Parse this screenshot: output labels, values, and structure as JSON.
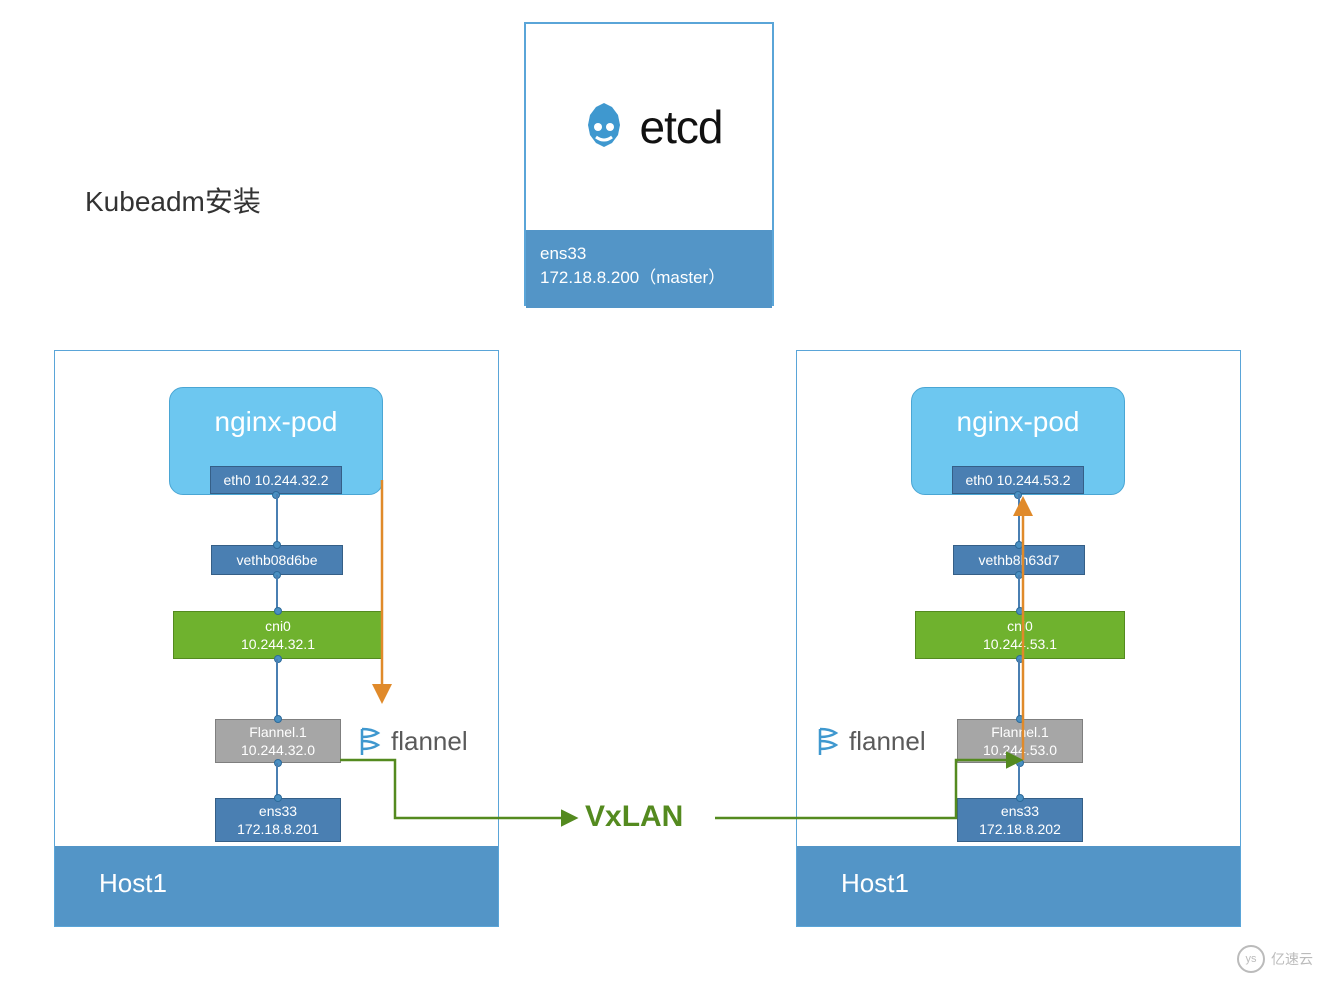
{
  "title": "Kubeadm安装",
  "master": {
    "logo_text": "etcd",
    "iface": "ens33",
    "ip_label": "172.18.8.200（master）"
  },
  "vxlan_label": "VxLAN",
  "hosts": [
    {
      "host_label": "Host1",
      "pod_name": "nginx-pod",
      "pod_eth": "eth0 10.244.32.2",
      "veth": "vethb08d6be",
      "cni_name": "cni0",
      "cni_ip": "10.244.32.1",
      "flannel_name": "Flannel.1",
      "flannel_ip": "10.244.32.0",
      "flannel_brand": "flannel",
      "ens_name": "ens33",
      "ens_ip": "172.18.8.201"
    },
    {
      "host_label": "Host1",
      "pod_name": "nginx-pod",
      "pod_eth": "eth0 10.244.53.2",
      "veth": "vethb8h63d7",
      "cni_name": "cni0",
      "cni_ip": "10.244.53.1",
      "flannel_name": "Flannel.1",
      "flannel_ip": "10.244.53.0",
      "flannel_brand": "flannel",
      "ens_name": "ens33",
      "ens_ip": "172.18.8.202"
    }
  ],
  "watermark": "亿速云",
  "colors": {
    "blue": "#5395c7",
    "lightblue": "#6dc7f0",
    "green": "#6fb22e",
    "gray": "#a6a6a6",
    "orange": "#e08a2a"
  },
  "chart_data": {
    "type": "diagram",
    "description": "Kubernetes flannel VxLAN overlay network between two hosts via etcd master",
    "nodes": [
      {
        "id": "master",
        "label": "etcd",
        "iface": "ens33",
        "ip": "172.18.8.200",
        "role": "master"
      },
      {
        "id": "host1",
        "label": "Host1",
        "ens_ip": "172.18.8.201",
        "flannel_ip": "10.244.32.0",
        "cni_ip": "10.244.32.1",
        "pod_ip": "10.244.32.2",
        "veth": "vethb08d6be"
      },
      {
        "id": "host2",
        "label": "Host1",
        "ens_ip": "172.18.8.202",
        "flannel_ip": "10.244.53.0",
        "cni_ip": "10.244.53.1",
        "pod_ip": "10.244.53.2",
        "veth": "vethb8h63d7"
      }
    ],
    "edges": [
      {
        "from": "host1.pod",
        "to": "host1.veth",
        "via": "link"
      },
      {
        "from": "host1.veth",
        "to": "host1.cni0",
        "via": "link"
      },
      {
        "from": "host1.cni0",
        "to": "host1.flannel",
        "via": "link"
      },
      {
        "from": "host1.flannel",
        "to": "host1.ens33",
        "via": "link"
      },
      {
        "from": "host1.ens33",
        "to": "host2.ens33",
        "via": "VxLAN"
      },
      {
        "from": "host2.ens33",
        "to": "host2.flannel",
        "via": "link"
      },
      {
        "from": "host2.flannel",
        "to": "host2.cni0",
        "via": "link"
      },
      {
        "from": "host2.cni0",
        "to": "host2.veth",
        "via": "link"
      },
      {
        "from": "host2.veth",
        "to": "host2.pod",
        "via": "link"
      },
      {
        "from": "host1.pod",
        "to": "host1.flannel",
        "via": "orange-arrow",
        "direction": "down"
      },
      {
        "from": "host2.flannel",
        "to": "host2.pod",
        "via": "orange-arrow",
        "direction": "up"
      }
    ]
  }
}
